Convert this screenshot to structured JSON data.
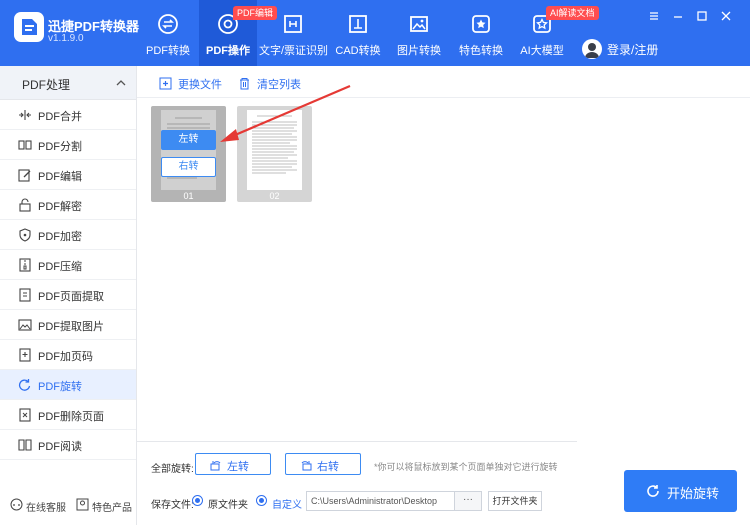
{
  "app": {
    "name": "迅捷PDF转换器",
    "version": "v1.1.9.0"
  },
  "nav": [
    {
      "label": "PDF转换",
      "icon": "pdf-convert-icon"
    },
    {
      "label": "PDF操作",
      "icon": "pdf-operate-icon",
      "badge": "PDF编辑",
      "active": true
    },
    {
      "label": "文字/票证识别",
      "icon": "ocr-scan-icon"
    },
    {
      "label": "CAD转换",
      "icon": "cad-icon"
    },
    {
      "label": "图片转换",
      "icon": "image-icon"
    },
    {
      "label": "特色转换",
      "icon": "star-icon"
    },
    {
      "label": "AI大模型",
      "icon": "ai-star-icon",
      "badge": "AI解读文档"
    }
  ],
  "user": {
    "login_label": "登录/注册"
  },
  "sidebar": {
    "header": "PDF处理",
    "items": [
      {
        "label": "PDF合并",
        "icon": "merge-icon"
      },
      {
        "label": "PDF分割",
        "icon": "split-icon"
      },
      {
        "label": "PDF编辑",
        "icon": "edit-icon"
      },
      {
        "label": "PDF解密",
        "icon": "unlock-icon"
      },
      {
        "label": "PDF加密",
        "icon": "shield-lock-icon"
      },
      {
        "label": "PDF压缩",
        "icon": "compress-icon"
      },
      {
        "label": "PDF页面提取",
        "icon": "page-extract-icon"
      },
      {
        "label": "PDF提取图片",
        "icon": "image-extract-icon"
      },
      {
        "label": "PDF加页码",
        "icon": "page-number-icon"
      },
      {
        "label": "PDF旋转",
        "icon": "rotate-icon",
        "active": true
      },
      {
        "label": "PDF删除页面",
        "icon": "page-delete-icon"
      },
      {
        "label": "PDF阅读",
        "icon": "book-icon"
      }
    ],
    "footer": {
      "service": "在线客服",
      "products": "特色产品"
    }
  },
  "toolbar": {
    "replace_file": "更换文件",
    "clear_list": "清空列表"
  },
  "thumbnails": [
    {
      "number": "01",
      "rotate_left": "左转",
      "rotate_right": "右转"
    },
    {
      "number": "02"
    }
  ],
  "controls": {
    "rotate_all_label": "全部旋转:",
    "rotate_left": "左转",
    "rotate_right": "右转",
    "hint": "*你可以将鼠标放到某个页面单独对它进行旋转",
    "save_label": "保存文件:",
    "option_original": "原文件夹",
    "option_custom": "自定义",
    "path": "C:\\Users\\Administrator\\Desktop",
    "browse": "···",
    "open_folder": "打开文件夹",
    "start": "开始旋转"
  },
  "colors": {
    "brand": "#2f6ff0",
    "active_nav": "#1f5ad8",
    "badge": "#ff4d4f",
    "annotation_arrow": "#e53935"
  }
}
